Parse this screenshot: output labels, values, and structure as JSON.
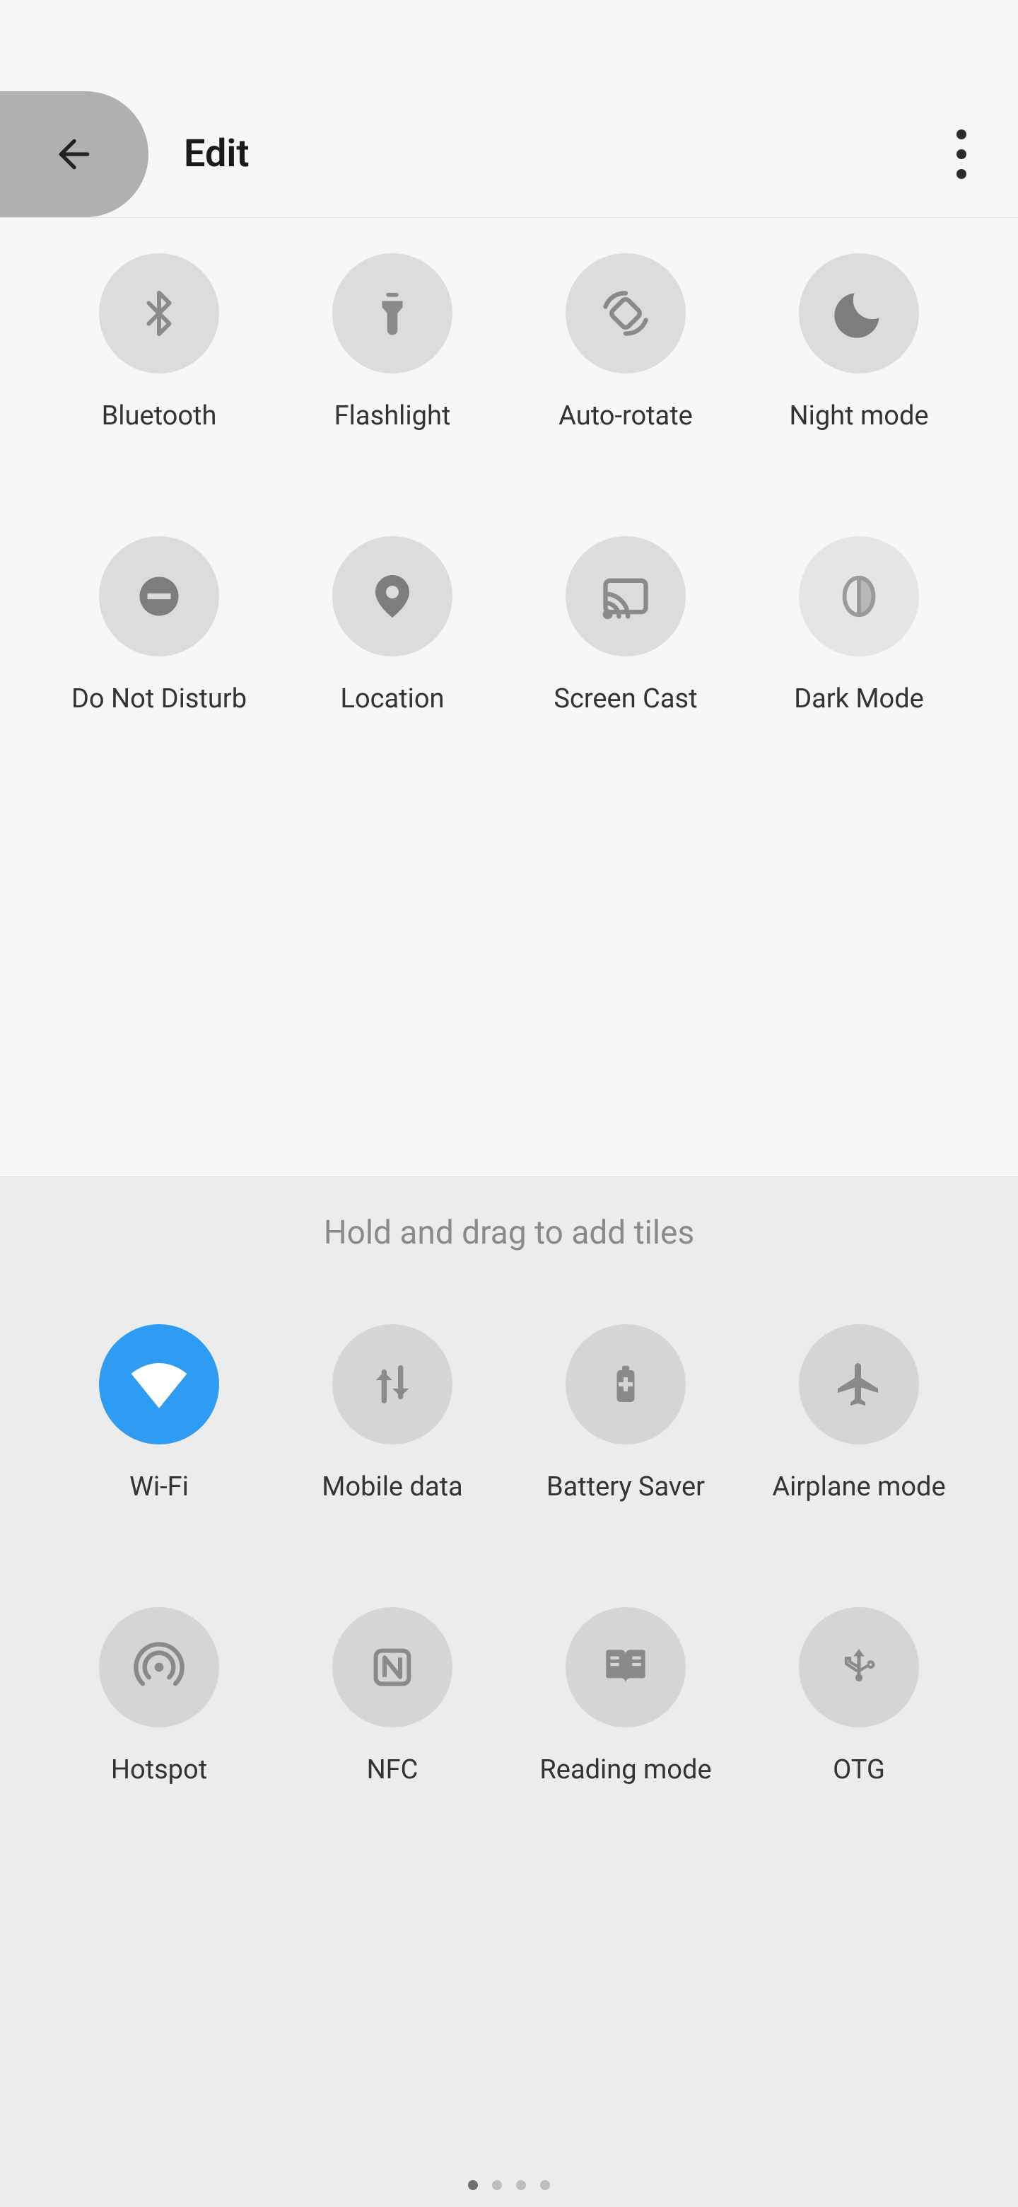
{
  "header": {
    "title": "Edit"
  },
  "current_tiles": [
    {
      "id": "bluetooth",
      "label": "Bluetooth",
      "icon": "bluetooth",
      "active": false
    },
    {
      "id": "flashlight",
      "label": "Flashlight",
      "icon": "flashlight",
      "active": false
    },
    {
      "id": "autorotate",
      "label": "Auto-rotate",
      "icon": "autorotate",
      "active": false
    },
    {
      "id": "nightmode",
      "label": "Night mode",
      "icon": "moon",
      "active": false
    },
    {
      "id": "dnd",
      "label": "Do Not Disturb",
      "icon": "dnd",
      "active": false
    },
    {
      "id": "location",
      "label": "Location",
      "icon": "location",
      "active": false
    },
    {
      "id": "screencast",
      "label": "Screen Cast",
      "icon": "cast",
      "active": false
    },
    {
      "id": "darkmode",
      "label": "Dark Mode",
      "icon": "contrast",
      "active": false
    }
  ],
  "lower": {
    "hint": "Hold and drag to add tiles"
  },
  "available_tiles": [
    {
      "id": "wifi",
      "label": "Wi-Fi",
      "icon": "wifi",
      "active": true
    },
    {
      "id": "mobiledata",
      "label": "Mobile data",
      "icon": "data",
      "active": false
    },
    {
      "id": "battery",
      "label": "Battery Saver",
      "icon": "battery",
      "active": false
    },
    {
      "id": "airplane",
      "label": "Airplane mode",
      "icon": "airplane",
      "active": false
    },
    {
      "id": "hotspot",
      "label": "Hotspot",
      "icon": "hotspot",
      "active": false
    },
    {
      "id": "nfc",
      "label": "NFC",
      "icon": "nfc",
      "active": false
    },
    {
      "id": "reading",
      "label": "Reading mode",
      "icon": "book",
      "active": false
    },
    {
      "id": "otg",
      "label": "OTG",
      "icon": "usb",
      "active": false
    }
  ],
  "pager": {
    "pages": 4,
    "current_index": 0
  }
}
